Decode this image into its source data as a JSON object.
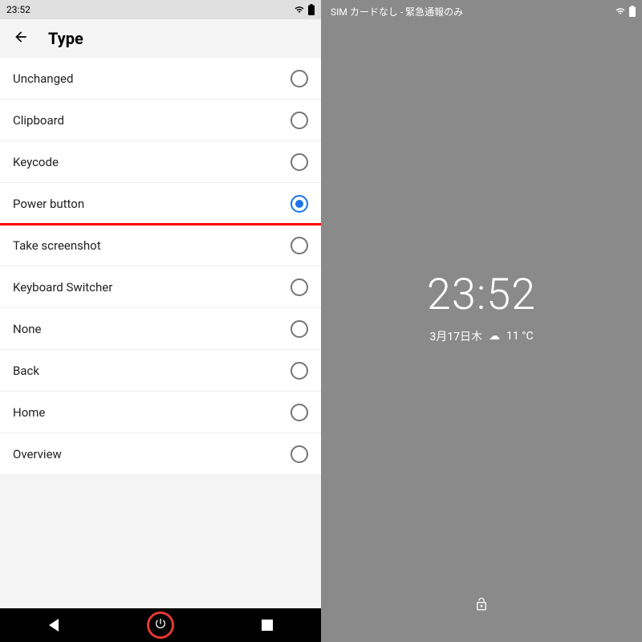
{
  "left": {
    "status_time": "23:52",
    "header_title": "Type",
    "options": [
      {
        "label": "Unchanged",
        "selected": false
      },
      {
        "label": "Clipboard",
        "selected": false
      },
      {
        "label": "Keycode",
        "selected": false
      },
      {
        "label": "Power button",
        "selected": true
      },
      {
        "label": "Take screenshot",
        "selected": false
      },
      {
        "label": "Keyboard Switcher",
        "selected": false
      },
      {
        "label": "None",
        "selected": false
      },
      {
        "label": "Back",
        "selected": false
      },
      {
        "label": "Home",
        "selected": false
      },
      {
        "label": "Overview",
        "selected": false
      }
    ]
  },
  "right": {
    "status_text": "SIM カードなし - 緊急通報のみ",
    "clock": "23:52",
    "date": "3月17日木",
    "temp": "11 °C"
  }
}
